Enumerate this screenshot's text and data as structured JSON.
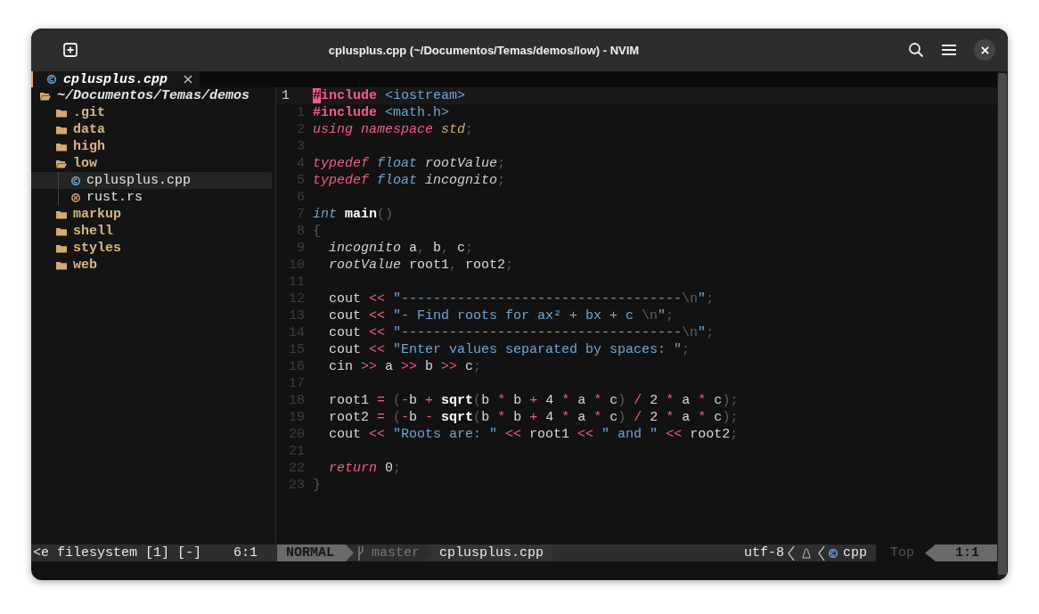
{
  "window": {
    "title": "cplusplus.cpp (~/Documentos/Temas/demos/low) - NVIM"
  },
  "tabs": [
    {
      "label": "cplusplus.cpp",
      "selected": true
    }
  ],
  "file_tree": {
    "root": {
      "label": "~/Documentos/Temas/demos",
      "kind": "folder",
      "expanded": true,
      "selected": false,
      "children": [
        {
          "label": ".git",
          "kind": "folder",
          "expanded": false,
          "selected": false
        },
        {
          "label": "data",
          "kind": "folder",
          "expanded": false,
          "selected": false
        },
        {
          "label": "high",
          "kind": "folder",
          "expanded": false,
          "selected": false
        },
        {
          "label": "low",
          "kind": "folder",
          "expanded": true,
          "selected": false,
          "children": [
            {
              "label": "cplusplus.cpp",
              "kind": "cpp",
              "selected": true
            },
            {
              "label": "rust.rs",
              "kind": "rust",
              "selected": false
            }
          ]
        },
        {
          "label": "markup",
          "kind": "folder",
          "expanded": false,
          "selected": false
        },
        {
          "label": "shell",
          "kind": "folder",
          "expanded": false,
          "selected": false
        },
        {
          "label": "styles",
          "kind": "folder",
          "expanded": false,
          "selected": false
        },
        {
          "label": "web",
          "kind": "folder",
          "expanded": false,
          "selected": false
        }
      ]
    }
  },
  "editor": {
    "lines": [
      {
        "number": "1",
        "current": true,
        "tokens": [
          {
            "kind": "cursor",
            "text": "#"
          },
          {
            "kind": "kw",
            "text": "include "
          },
          {
            "kind": "str",
            "text": "<iostream>"
          }
        ]
      },
      {
        "number": "1",
        "current": false,
        "tokens": [
          {
            "kind": "kw",
            "text": "#include "
          },
          {
            "kind": "str",
            "text": "<math.h>"
          }
        ]
      },
      {
        "number": "2",
        "current": false,
        "tokens": [
          {
            "kind": "kwi",
            "text": "using "
          },
          {
            "kind": "kwi",
            "text": "namespace "
          },
          {
            "kind": "ns",
            "text": "std"
          },
          {
            "kind": "punct",
            "text": ";"
          }
        ]
      },
      {
        "number": "3",
        "current": false
      },
      {
        "number": "4",
        "current": false,
        "tokens": [
          {
            "kind": "kwi",
            "text": "typedef "
          },
          {
            "kind": "type",
            "text": "float "
          },
          {
            "kind": "ital",
            "text": "rootValue"
          },
          {
            "kind": "punct",
            "text": ";"
          }
        ]
      },
      {
        "number": "5",
        "current": false,
        "tokens": [
          {
            "kind": "kwi",
            "text": "typedef "
          },
          {
            "kind": "type",
            "text": "float "
          },
          {
            "kind": "ital",
            "text": "incognito"
          },
          {
            "kind": "punct",
            "text": ";"
          }
        ]
      },
      {
        "number": "6",
        "current": false
      },
      {
        "number": "7",
        "current": false,
        "tokens": [
          {
            "kind": "type",
            "text": "int "
          },
          {
            "kind": "bold",
            "text": "main"
          },
          {
            "kind": "punct",
            "text": "()"
          }
        ]
      },
      {
        "number": "8",
        "current": false,
        "tokens": [
          {
            "kind": "punct",
            "text": "{"
          }
        ]
      },
      {
        "number": "9",
        "current": false,
        "tokens": [
          {
            "kind": "ital",
            "text": "  incognito"
          },
          {
            "kind": "plain",
            "text": " a"
          },
          {
            "kind": "punct",
            "text": ","
          },
          {
            "kind": "plain",
            "text": " b"
          },
          {
            "kind": "punct",
            "text": ","
          },
          {
            "kind": "plain",
            "text": " c"
          },
          {
            "kind": "punct",
            "text": ";"
          }
        ]
      },
      {
        "number": "10",
        "current": false,
        "tokens": [
          {
            "kind": "ital",
            "text": "  rootValue"
          },
          {
            "kind": "plain",
            "text": " root1"
          },
          {
            "kind": "punct",
            "text": ","
          },
          {
            "kind": "plain",
            "text": " root2"
          },
          {
            "kind": "punct",
            "text": ";"
          }
        ]
      },
      {
        "number": "11",
        "current": false
      },
      {
        "number": "12",
        "current": false,
        "tokens": [
          {
            "kind": "plain",
            "text": "  cout "
          },
          {
            "kind": "op",
            "text": "<< "
          },
          {
            "kind": "str",
            "text": "\"-----------------------------------"
          },
          {
            "kind": "esc",
            "text": "\\n"
          },
          {
            "kind": "str",
            "text": "\""
          },
          {
            "kind": "punct",
            "text": ";"
          }
        ]
      },
      {
        "number": "13",
        "current": false,
        "tokens": [
          {
            "kind": "plain",
            "text": "  cout "
          },
          {
            "kind": "op",
            "text": "<< "
          },
          {
            "kind": "str",
            "text": "\"- Find roots for ax² + bx + c "
          },
          {
            "kind": "esc",
            "text": "\\n"
          },
          {
            "kind": "str",
            "text": "\""
          },
          {
            "kind": "punct",
            "text": ";"
          }
        ]
      },
      {
        "number": "14",
        "current": false,
        "tokens": [
          {
            "kind": "plain",
            "text": "  cout "
          },
          {
            "kind": "op",
            "text": "<< "
          },
          {
            "kind": "str",
            "text": "\"-----------------------------------"
          },
          {
            "kind": "esc",
            "text": "\\n"
          },
          {
            "kind": "str",
            "text": "\""
          },
          {
            "kind": "punct",
            "text": ";"
          }
        ]
      },
      {
        "number": "15",
        "current": false,
        "tokens": [
          {
            "kind": "plain",
            "text": "  cout "
          },
          {
            "kind": "op",
            "text": "<< "
          },
          {
            "kind": "str",
            "text": "\"Enter values separated by spaces: \""
          },
          {
            "kind": "punct",
            "text": ";"
          }
        ]
      },
      {
        "number": "16",
        "current": false,
        "tokens": [
          {
            "kind": "plain",
            "text": "  cin "
          },
          {
            "kind": "op",
            "text": ">>"
          },
          {
            "kind": "plain",
            "text": " a "
          },
          {
            "kind": "op",
            "text": ">>"
          },
          {
            "kind": "plain",
            "text": " b "
          },
          {
            "kind": "op",
            "text": ">>"
          },
          {
            "kind": "plain",
            "text": " c"
          },
          {
            "kind": "punct",
            "text": ";"
          }
        ]
      },
      {
        "number": "17",
        "current": false
      },
      {
        "number": "18",
        "current": false,
        "tokens": [
          {
            "kind": "plain",
            "text": "  root1 "
          },
          {
            "kind": "op",
            "text": "= "
          },
          {
            "kind": "punct",
            "text": "("
          },
          {
            "kind": "op",
            "text": "-"
          },
          {
            "kind": "plain",
            "text": "b "
          },
          {
            "kind": "op",
            "text": "+ "
          },
          {
            "kind": "bold",
            "text": "sqrt"
          },
          {
            "kind": "punct",
            "text": "("
          },
          {
            "kind": "plain",
            "text": "b "
          },
          {
            "kind": "op",
            "text": "*"
          },
          {
            "kind": "plain",
            "text": " b "
          },
          {
            "kind": "op",
            "text": "+"
          },
          {
            "kind": "plain",
            "text": " 4 "
          },
          {
            "kind": "op",
            "text": "*"
          },
          {
            "kind": "plain",
            "text": " a "
          },
          {
            "kind": "op",
            "text": "*"
          },
          {
            "kind": "plain",
            "text": " c"
          },
          {
            "kind": "punct",
            "text": ") "
          },
          {
            "kind": "op",
            "text": "/"
          },
          {
            "kind": "plain",
            "text": " 2 "
          },
          {
            "kind": "op",
            "text": "*"
          },
          {
            "kind": "plain",
            "text": " a "
          },
          {
            "kind": "op",
            "text": "*"
          },
          {
            "kind": "plain",
            "text": " c"
          },
          {
            "kind": "punct",
            "text": ");"
          }
        ]
      },
      {
        "number": "19",
        "current": false,
        "tokens": [
          {
            "kind": "plain",
            "text": "  root2 "
          },
          {
            "kind": "op",
            "text": "= "
          },
          {
            "kind": "punct",
            "text": "("
          },
          {
            "kind": "op",
            "text": "-"
          },
          {
            "kind": "plain",
            "text": "b "
          },
          {
            "kind": "op",
            "text": "- "
          },
          {
            "kind": "bold",
            "text": "sqrt"
          },
          {
            "kind": "punct",
            "text": "("
          },
          {
            "kind": "plain",
            "text": "b "
          },
          {
            "kind": "op",
            "text": "*"
          },
          {
            "kind": "plain",
            "text": " b "
          },
          {
            "kind": "op",
            "text": "+"
          },
          {
            "kind": "plain",
            "text": " 4 "
          },
          {
            "kind": "op",
            "text": "*"
          },
          {
            "kind": "plain",
            "text": " a "
          },
          {
            "kind": "op",
            "text": "*"
          },
          {
            "kind": "plain",
            "text": " c"
          },
          {
            "kind": "punct",
            "text": ") "
          },
          {
            "kind": "op",
            "text": "/"
          },
          {
            "kind": "plain",
            "text": " 2 "
          },
          {
            "kind": "op",
            "text": "*"
          },
          {
            "kind": "plain",
            "text": " a "
          },
          {
            "kind": "op",
            "text": "*"
          },
          {
            "kind": "plain",
            "text": " c"
          },
          {
            "kind": "punct",
            "text": ");"
          }
        ]
      },
      {
        "number": "20",
        "current": false,
        "tokens": [
          {
            "kind": "plain",
            "text": "  cout "
          },
          {
            "kind": "op",
            "text": "<< "
          },
          {
            "kind": "str",
            "text": "\"Roots are: \" "
          },
          {
            "kind": "op",
            "text": "<<"
          },
          {
            "kind": "plain",
            "text": " root1 "
          },
          {
            "kind": "op",
            "text": "<< "
          },
          {
            "kind": "str",
            "text": "\" and \" "
          },
          {
            "kind": "op",
            "text": "<<"
          },
          {
            "kind": "plain",
            "text": " root2"
          },
          {
            "kind": "punct",
            "text": ";"
          }
        ]
      },
      {
        "number": "21",
        "current": false
      },
      {
        "number": "22",
        "current": false,
        "tokens": [
          {
            "kind": "kwi",
            "text": "  return"
          },
          {
            "kind": "plain",
            "text": " 0"
          },
          {
            "kind": "punct",
            "text": ";"
          }
        ]
      },
      {
        "number": "23",
        "current": false,
        "tokens": [
          {
            "kind": "punct",
            "text": "}"
          }
        ]
      }
    ]
  },
  "status_bar": {
    "tree_buffer": "<e filesystem [1] [-]",
    "tree_position": "6:1",
    "mode": "NORMAL",
    "branch": "master",
    "file": "cplusplus.cpp",
    "encoding": "utf-8",
    "filetype": "cpp",
    "scroll": "Top",
    "position": "1:1"
  }
}
